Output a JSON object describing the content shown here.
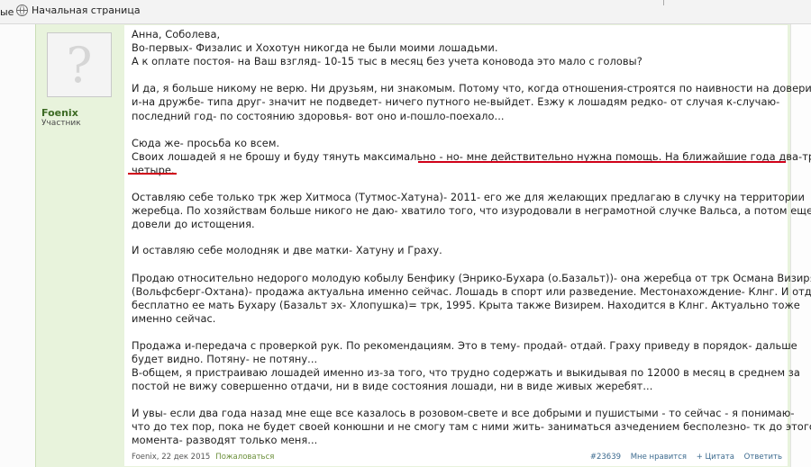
{
  "bookmarks": {
    "prev_label": "ые",
    "home_label": "Начальная страница"
  },
  "user": {
    "name": "Foenix",
    "title": "Участник",
    "avatar_glyph": "?"
  },
  "post": {
    "lines": [
      "Анна, Соболева,",
      "Во-первых- Физалис и Хохотун никогда не были моими лошадьми.",
      "А к оплате постоя- на Ваш взгляд- 10-15 тыс в месяц без учета коноводa это мало с головы?",
      "И да, я больше никому не верю. Ни друзьям, ни знакомым. Потому что, когда отношения-строятся по наивности на доверии,",
      "и-на дружбе- типа друг- значит не подведет- ничего путного не-выйдет. Езжу к лошадям редко- от случая к-случаю-",
      "последний год- по состоянию здоровья- вот оно и-пошло-поехало...",
      "Сюда же- просьба ко всем.",
      "Своих лошадей я не брошу и буду тянуть максимально - но- мне действительно нужна помощь. На ближайшие года два-три-",
      "четыре.",
      "Оставляю себе только трк жер Хитмоса (Тутмос-Хатуна)- 2011- его же для желающих предлагаю в случку на территории",
      "жеребца. По хозяйствам больше никого не даю- хватило того, что изуродовали в неграмотной случке Вальса, а потом еще и",
      "довели до истощения.",
      "И оставляю себе молодняк и две матки- Хатуну и Граху.",
      "Продаю относительно недорого молодую кобылу Бенфику (Энрико-Бухара (о.Базальт))- она жеребца от трк Османа Визиря",
      "(Вольфсберг-Охтана)- продажа актуальна именно сейчас. Лошадь в спорт или разведение. Местонахождение- Клнг. И отдаю",
      "бесплатно ее мать Бухару (Базальт эх- Хлопушка)= трк, 1995. Крыта также Визирем. Находится в Клнг. Актуально тоже",
      "именно сейчас.",
      "Продажа и-передача с проверкой рук. По рекомендациям. Это в тему- продай- отдай. Граху приведу в порядок- дальше",
      "будет видно. Потяну- не потяну...",
      "В-общем, я пристраиваю лошадей именно из-за того, что трудно содержать и выкидывая по 12000 в месяц в среднем за",
      "постой не вижу совершенно отдачи, ни в виде состояния лошади, ни в виде живых жеребят...",
      "И увы- если два года назад мне еще все казалось в розовом-свете и все добрыми и пушистыми - то сейчас - я понимаю-",
      "что до тех пор, пока не будет своей конюшни и не смогу там с ними жить- заниматься азчедением бесполезно- тк до этого",
      "момента- разводят только меня..."
    ]
  },
  "footer": {
    "author_date": "Foenix, 22 дек 2015",
    "complain": "Пожаловаться",
    "post_number": "#23639",
    "like": "Мне нравится",
    "quote": "+ Цитата",
    "reply": "Ответить"
  },
  "colors": {
    "underline": "#d00018",
    "panel_bg": "#e8f3dc",
    "username": "#3d6b24"
  }
}
